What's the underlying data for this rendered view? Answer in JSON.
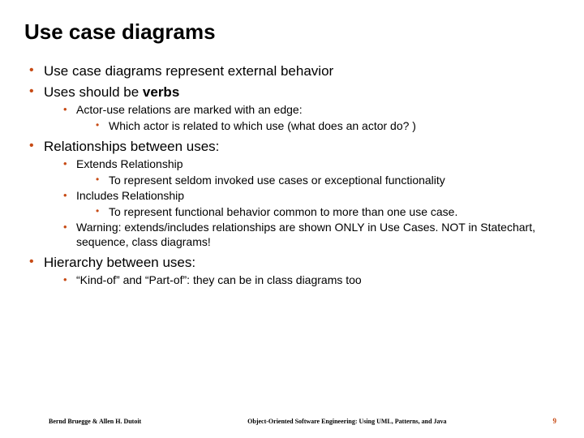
{
  "title": "Use case diagrams",
  "b1": "Use case diagrams represent external behavior",
  "b2a": "Uses should be ",
  "b2b": "verbs",
  "b2_1": "Actor-use relations are marked with an edge:",
  "b2_1_1": "Which actor is related to which use (what does an actor do? )",
  "b3": "Relationships between uses:",
  "b3_1": "Extends Relationship",
  "b3_1_1": "To represent seldom invoked use cases or exceptional functionality",
  "b3_2": "Includes Relationship",
  "b3_2_1": "To represent functional behavior common to more than one use case.",
  "b3_3": "Warning: extends/includes relationships are shown ONLY in Use Cases. NOT in Statechart, sequence, class diagrams!",
  "b4": "Hierarchy between uses:",
  "b4_1": "“Kind-of” and “Part-of”:  they can be in class diagrams too",
  "footer_left": "Bernd Bruegge & Allen H. Dutoit",
  "footer_center": "Object-Oriented Software Engineering: Using UML, Patterns, and Java",
  "footer_right": "9"
}
